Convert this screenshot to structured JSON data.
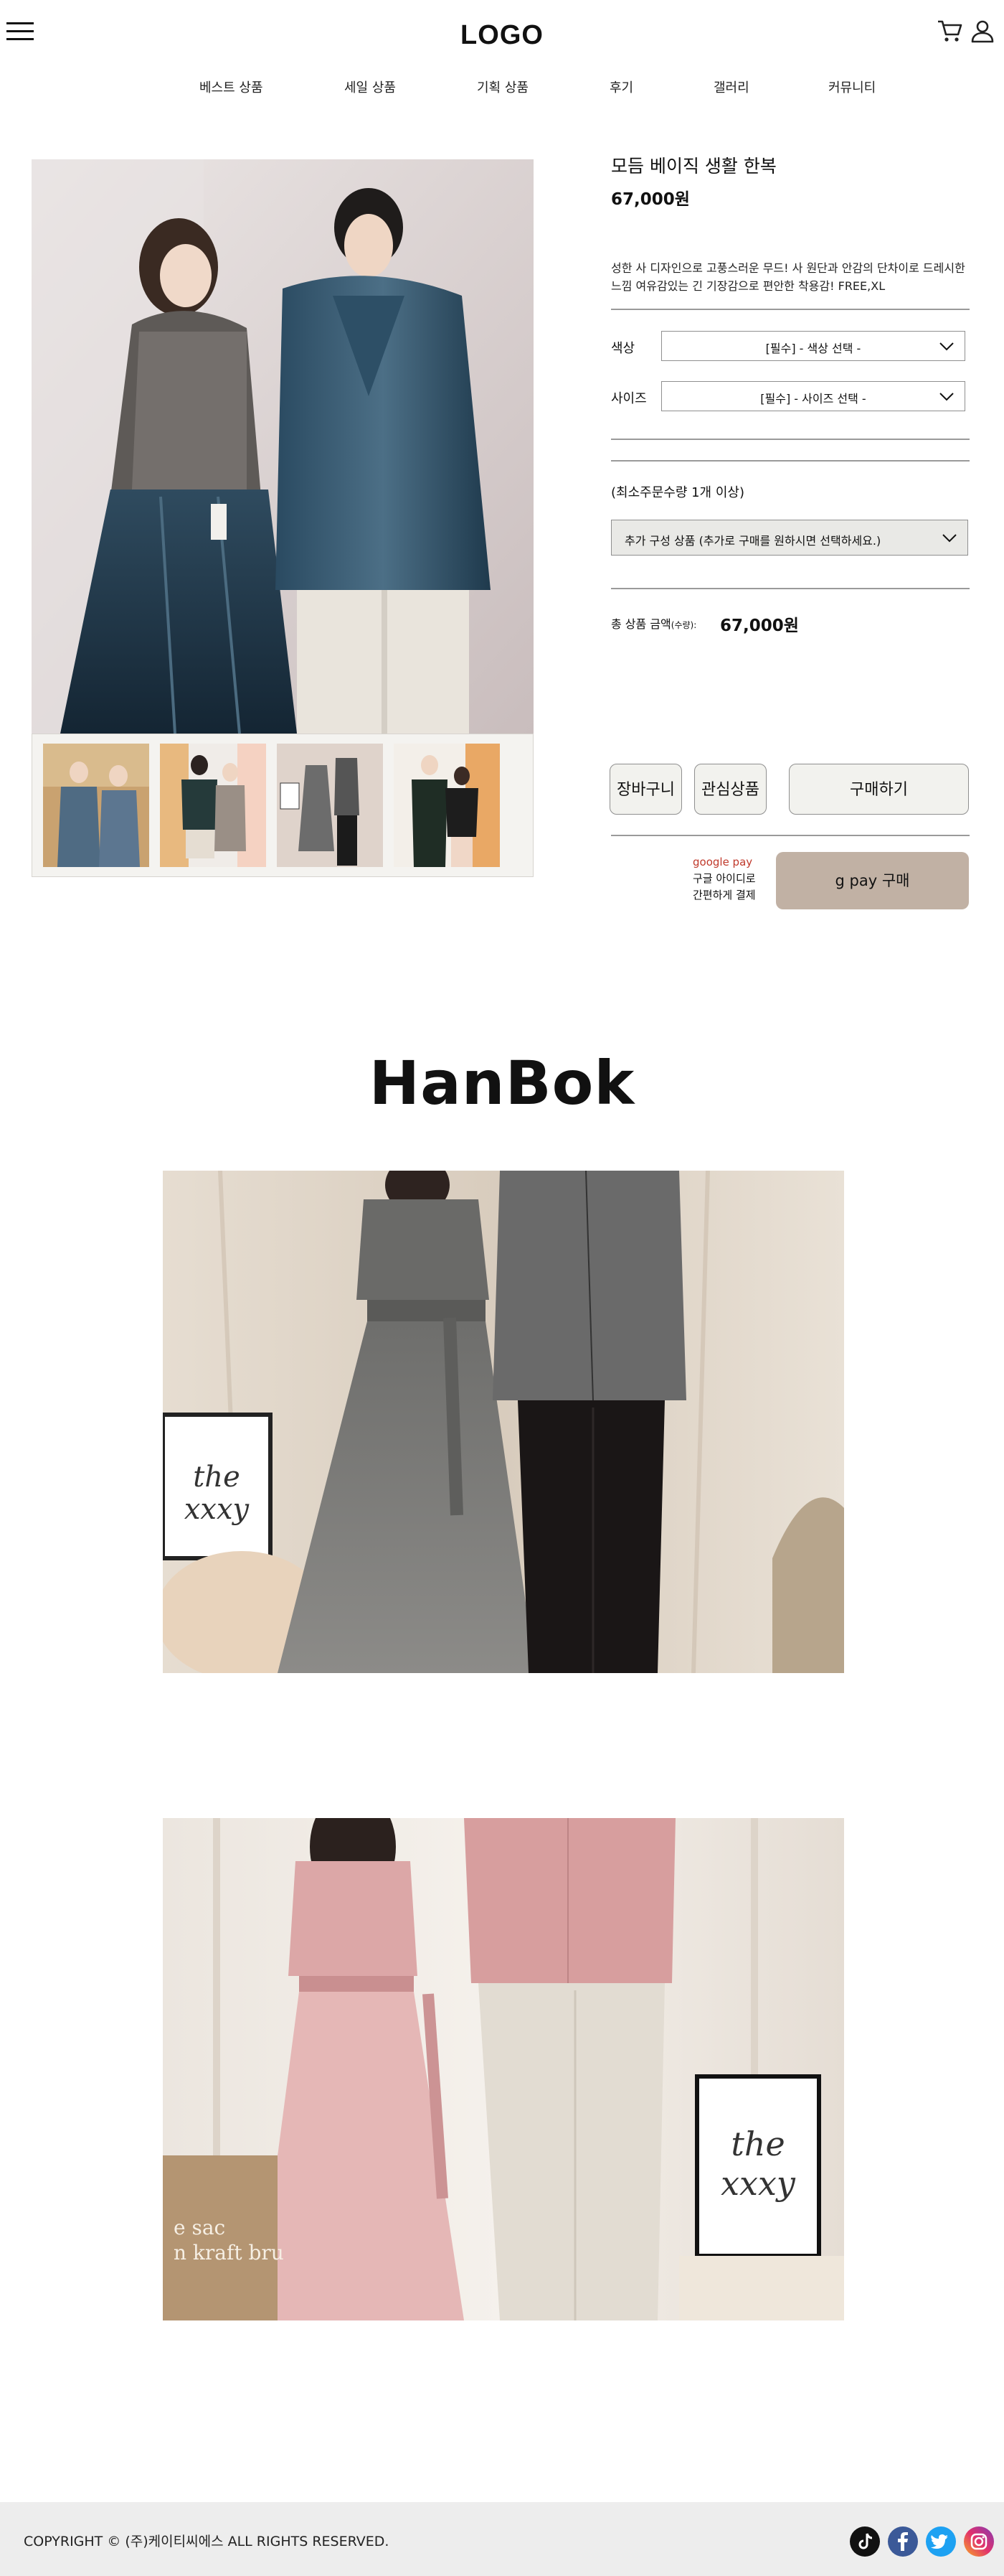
{
  "header": {
    "logo": "LOGO",
    "nav": [
      "베스트 상품",
      "세일 상품",
      "기획 상품",
      "후기",
      "갤러리",
      "커뮤니티"
    ]
  },
  "product": {
    "title": "모듬 베이직 생활 한복",
    "price": "67,000원",
    "description": "성한 사 디자인으로 고풍스러운 무드! 사 원단과 안감의 단차이로 드레시한 느낌 여유감있는 긴 기장감으로 편안한 착용감! FREE,XL",
    "color_label": "색상",
    "color_select": "[필수] - 색상 선택 -",
    "size_label": "사이즈",
    "size_select": "[필수] - 사이즈 선택 -",
    "min_order": "(최소주문수량 1개 이상)",
    "extra_select": "추가 구성 상품 (추가로 구매를 원하시면 선택하세요.)",
    "total_label": "총 상품 금액",
    "total_qty_label": "(수량):",
    "total_value": "67,000원"
  },
  "actions": {
    "cart": "장바구니",
    "wishlist": "관심상품",
    "buy": "구매하기",
    "gpay_brand": "google pay",
    "gpay_line1": "구글 아이디로",
    "gpay_line2": "간편하게 결제",
    "gpay_button": "g pay 구매"
  },
  "section_title": "HanBok",
  "footer": {
    "copyright": "COPYRIGHT © (주)케이티씨에스 ALL RIGHTS RESERVED.",
    "social": [
      "tiktok-icon",
      "facebook-icon",
      "twitter-icon",
      "instagram-icon"
    ]
  },
  "colors": {
    "accent_button": "#c1b1a4",
    "button_bg": "#f2f2ee",
    "footer_bg": "#ededed",
    "gpay_red": "#c0392b"
  }
}
